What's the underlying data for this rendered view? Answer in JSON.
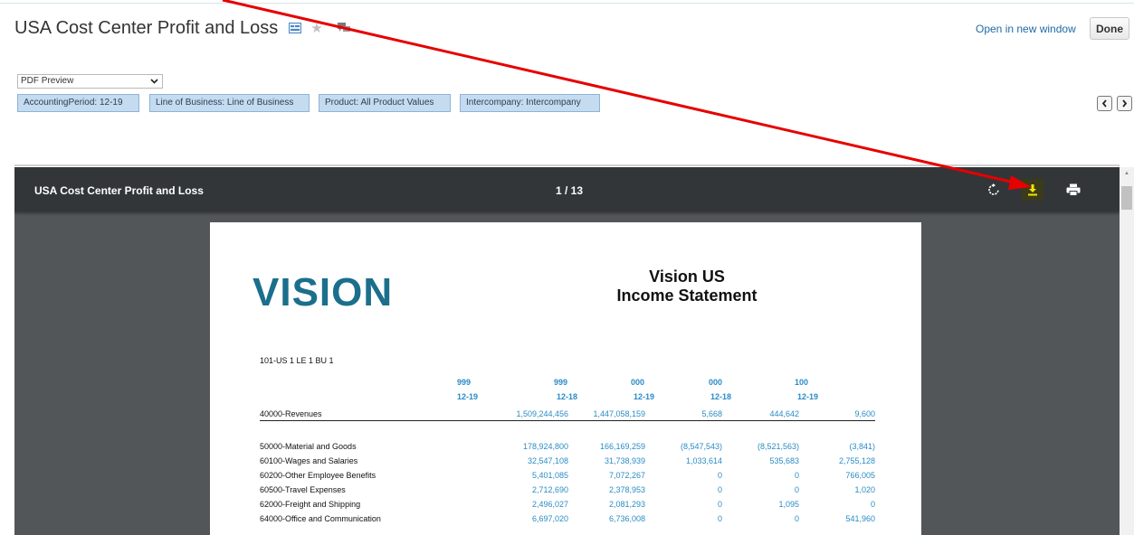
{
  "header": {
    "title": "USA Cost Center Profit and Loss",
    "open_in_new_window": "Open in new window",
    "done": "Done"
  },
  "output_select": {
    "value": "PDF Preview"
  },
  "filters": [
    {
      "label": "AccountingPeriod: 12-19"
    },
    {
      "label": "Line of Business: Line of Business"
    },
    {
      "label": "Product: All Product Values"
    },
    {
      "label": "Intercompany: Intercompany"
    }
  ],
  "viewer": {
    "doc_title": "USA Cost Center Profit and Loss",
    "page_count": "1 / 13"
  },
  "document": {
    "logo": "VISION",
    "company": "Vision US",
    "statement": "Income Statement",
    "entity": "101-US 1 LE 1 BU 1",
    "columns": [
      {
        "code": "999",
        "period": "12-19"
      },
      {
        "code": "999",
        "period": "12-18"
      },
      {
        "code": "000",
        "period": "12-19"
      },
      {
        "code": "000",
        "period": "12-18"
      },
      {
        "code": "100",
        "period": "12-19"
      }
    ],
    "revenue": {
      "label": "40000-Revenues",
      "values": [
        "1,509,244,456",
        "1,447,058,159",
        "5,668",
        "444,642",
        "9,600"
      ]
    },
    "rows": [
      {
        "label": "50000-Material and Goods",
        "values": [
          "178,924,800",
          "166,169,259",
          "(8,547,543)",
          "(8,521,563)",
          "(3,841)"
        ]
      },
      {
        "label": "60100-Wages and Salaries",
        "values": [
          "32,547,108",
          "31,738,939",
          "1,033,614",
          "535,683",
          "2,755,128"
        ]
      },
      {
        "label": "60200-Other Employee Benefits",
        "values": [
          "5,401,085",
          "7,072,267",
          "0",
          "0",
          "766,005"
        ]
      },
      {
        "label": "60500-Travel Expenses",
        "values": [
          "2,712,690",
          "2,378,953",
          "0",
          "0",
          "1,020"
        ]
      },
      {
        "label": "62000-Freight and Shipping",
        "values": [
          "2,496,027",
          "2,081,293",
          "0",
          "1,095",
          "0"
        ]
      },
      {
        "label": "64000-Office and Communication",
        "values": [
          "6,697,020",
          "6,736,008",
          "0",
          "0",
          "541,960"
        ]
      }
    ]
  },
  "colors": {
    "toolbar": "#323639",
    "viewer_bg": "#525659",
    "value_blue": "#2a8cc4",
    "chip_bg": "#c5dbf0",
    "arrow": "#e60000",
    "download_icon": "#f2e600"
  },
  "icons": [
    "report-icon",
    "star-icon",
    "comment-icon",
    "rotate-icon",
    "download-icon",
    "print-icon",
    "chevron-left-icon",
    "chevron-right-icon"
  ]
}
